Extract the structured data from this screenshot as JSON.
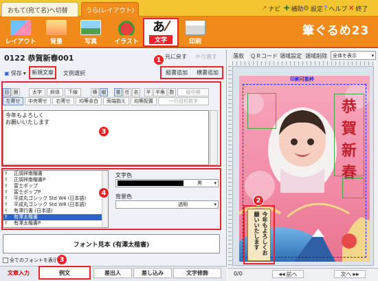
{
  "tabs": {
    "front_label": "おもて(宛て名)へ切替",
    "back_label": "うら(レイアウト)"
  },
  "top_menu": [
    {
      "icon": "navi-icon",
      "label": "ナビ"
    },
    {
      "icon": "help-assist-icon",
      "label": "補助"
    },
    {
      "icon": "settings-icon",
      "label": "設定"
    },
    {
      "icon": "help-icon",
      "label": "ヘルプ"
    },
    {
      "icon": "exit-icon",
      "label": "終了"
    }
  ],
  "toolbar": {
    "items": [
      {
        "icon": "layout-icon",
        "label": "レイアウト"
      },
      {
        "icon": "background-icon",
        "label": "背景"
      },
      {
        "icon": "photo-icon",
        "label": "写真"
      },
      {
        "icon": "illust-icon",
        "label": "イラスト"
      },
      {
        "icon": "text-icon",
        "label": "文字"
      },
      {
        "icon": "print-icon",
        "label": "印刷"
      }
    ],
    "brand": "筆ぐるめ23"
  },
  "document": {
    "title": "0122  恭賀新春001",
    "undo_label": "元に戻す",
    "redo_label": "やり直す",
    "save_label": "保存",
    "new_text_label": "新規文章",
    "text_select_label": "文例選択",
    "vertical_add_label": "縦書追加",
    "horizontal_add_label": "横書追加"
  },
  "format_row1": [
    "目",
    "圏",
    "太字",
    "斜体",
    "下線",
    "横",
    "縦",
    "普",
    "任",
    "名",
    "半",
    "半角",
    "数",
    "縦中横"
  ],
  "format_row2": [
    "左寄せ",
    "中央寄せ",
    "右寄せ",
    "均等余白",
    "両端揃え",
    "均等配置",
    "一行目桁数字"
  ],
  "text_content": "今年もよろしく\nお願いいたします",
  "fonts": {
    "items": [
      "正調祥南楷書",
      "正調祥南楷書P",
      "富士ポップ",
      "富士ポップP",
      "平成丸ゴシック Std W4 (日本語)",
      "平成丸ゴシック Std W8 (日本語)",
      "有澤行書 (日本語)",
      "有澤太楷書",
      "有澤太楷書P"
    ],
    "selected_index": 7,
    "text_color_label": "文字色",
    "text_color_value": "黒",
    "bg_color_label": "背景色",
    "bg_color_value": "透明",
    "sample_text": "フォント見本 (有澤太楷書)",
    "show_all_label": "全てのフォントを表示する"
  },
  "bottom_buttons": {
    "input_label": "文章入力",
    "example_label": "例文",
    "sender_label": "差出人",
    "insert_label": "差し込み",
    "decoration_label": "文字修飾"
  },
  "right_toolbar": {
    "items": [
      "落款",
      "ＱＲコード",
      "領域設定",
      "領域削除"
    ],
    "view_select": "全体を表示"
  },
  "card": {
    "printable_label": "印刷可能枠",
    "greeting_chars": [
      "恭",
      "賀",
      "新",
      "春"
    ],
    "message_text": "今年もよろしくお願いいたします"
  },
  "page_nav": {
    "page_value": "0/0",
    "prev_label": "前へ",
    "next_label": "次へ"
  },
  "badges": [
    "1",
    "2",
    "3",
    "4",
    "3"
  ],
  "colors": {
    "top_bar": "#f5c531",
    "toolbar": "#f08a1b",
    "highlight": "#e8242a",
    "selected": "#2d63c8",
    "card_bg": "#f7a8bd"
  }
}
